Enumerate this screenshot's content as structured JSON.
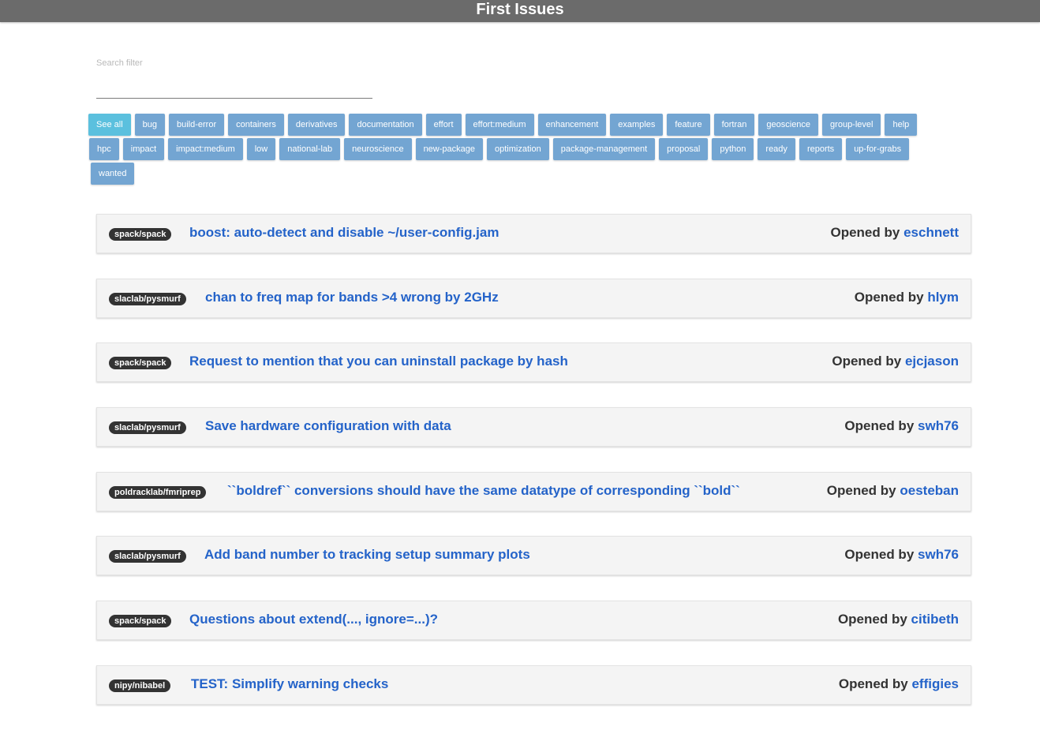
{
  "header": {
    "title": "First Issues"
  },
  "search": {
    "placeholder": "Search filter",
    "value": ""
  },
  "tags": {
    "row1": [
      "See all",
      "bug",
      "build-error",
      "containers",
      "derivatives",
      "documentation",
      "effort",
      "effort:medium",
      "enhancement",
      "examples",
      "feature",
      "fortran",
      "geoscience",
      "group-level",
      "help"
    ],
    "row2": [
      "hpc",
      "impact",
      "impact:medium",
      "low",
      "national-lab",
      "neuroscience",
      "new-package",
      "optimization",
      "package-management",
      "proposal",
      "python",
      "ready",
      "reports",
      "up-for-grabs"
    ],
    "row3": [
      "wanted"
    ],
    "active": "See all"
  },
  "issues": [
    {
      "repo": "spack/spack",
      "title": "boost: auto-detect and disable ~/user-config.jam",
      "opened_by_label": "Opened by",
      "author": "eschnett"
    },
    {
      "repo": "slaclab/pysmurf",
      "title": "chan to freq map for bands >4 wrong by 2GHz",
      "opened_by_label": "Opened by",
      "author": "hlym"
    },
    {
      "repo": "spack/spack",
      "title": "Request to mention that you can uninstall package by hash",
      "opened_by_label": "Opened by",
      "author": "ejcjason"
    },
    {
      "repo": "slaclab/pysmurf",
      "title": "Save hardware configuration with data",
      "opened_by_label": "Opened by",
      "author": "swh76"
    },
    {
      "repo": "poldracklab/fmriprep",
      "title": "``boldref`` conversions should have the same datatype of corresponding ``bold``",
      "opened_by_label": "Opened by",
      "author": "oesteban"
    },
    {
      "repo": "slaclab/pysmurf",
      "title": "Add band number to tracking setup summary plots",
      "opened_by_label": "Opened by",
      "author": "swh76"
    },
    {
      "repo": "spack/spack",
      "title": "Questions about extend(..., ignore=...)?",
      "opened_by_label": "Opened by",
      "author": "citibeth"
    },
    {
      "repo": "nipy/nibabel",
      "title": "TEST: Simplify warning checks",
      "opened_by_label": "Opened by",
      "author": "effigies"
    }
  ],
  "colors": {
    "header_bg": "#6b6b6b",
    "tag_bg": "#73a5d2",
    "tag_active_bg": "#5bc0de",
    "link": "#2463c9",
    "repo_badge_bg": "#333333",
    "card_bg": "#f4f4f4"
  }
}
